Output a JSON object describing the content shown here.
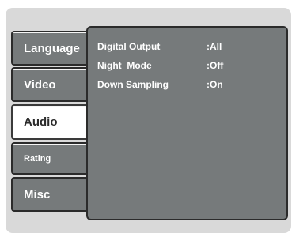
{
  "menu": {
    "tabs": [
      {
        "label": "Language",
        "active": false
      },
      {
        "label": "Video",
        "active": false
      },
      {
        "label": "Audio",
        "active": true
      },
      {
        "label": "Rating",
        "active": false
      },
      {
        "label": "Misc",
        "active": false
      }
    ]
  },
  "audio_settings": [
    {
      "label": "Digital Output",
      "value": "All"
    },
    {
      "label": "Night  Mode",
      "value": "Off"
    },
    {
      "label": "Down Sampling",
      "value": "On"
    }
  ],
  "colors": {
    "panel": "#767a7b",
    "frame": "#d9d9d9",
    "active_tab": "#ffffff",
    "text": "#ffffff"
  }
}
